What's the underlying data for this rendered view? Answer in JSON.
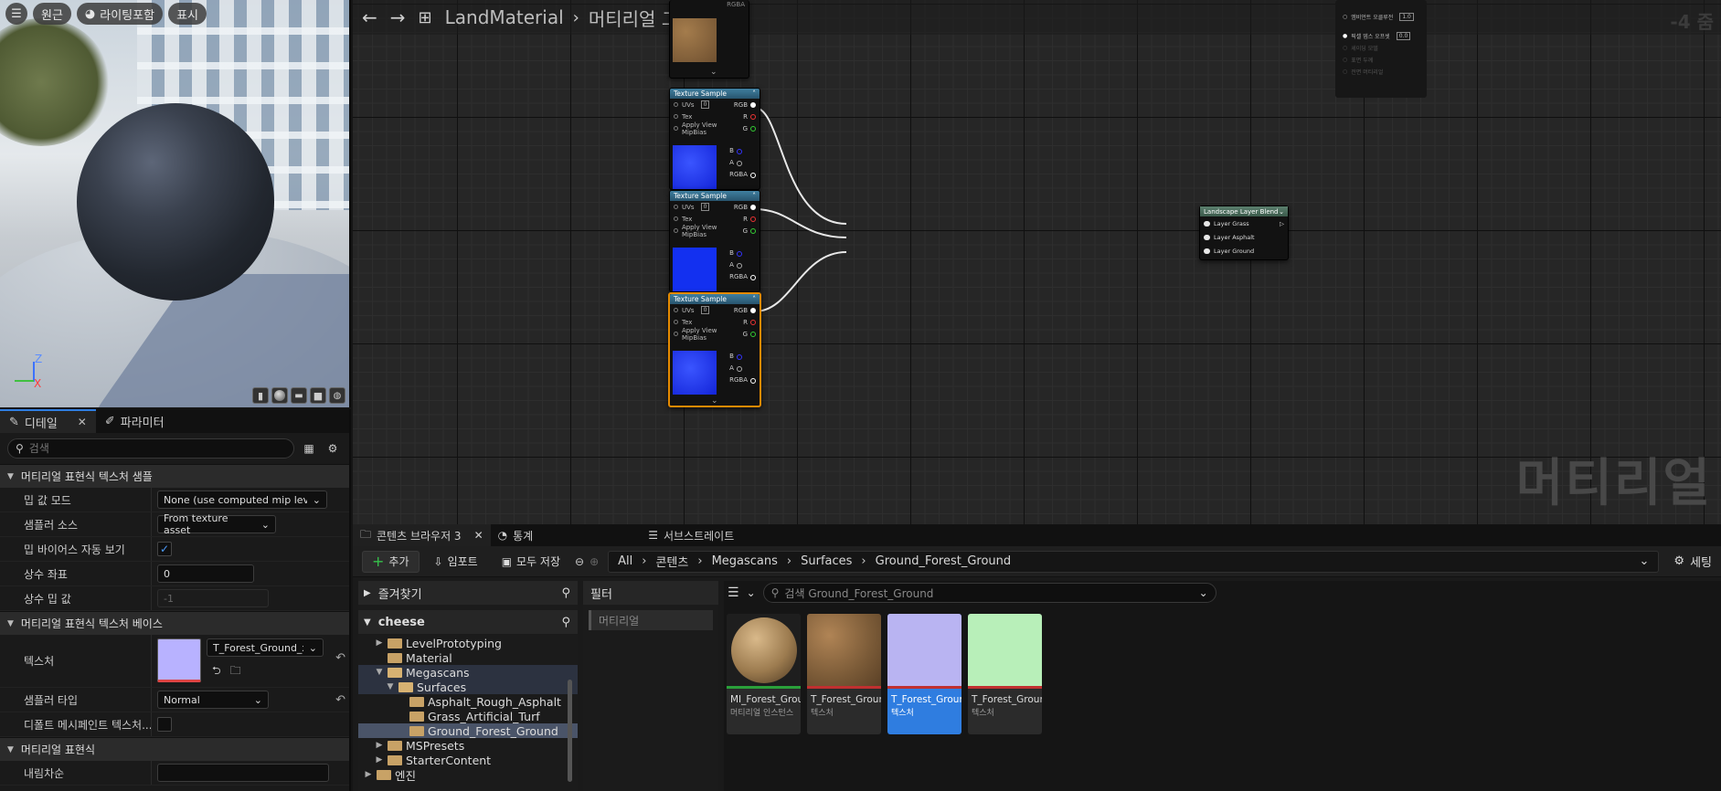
{
  "viewport": {
    "toolbar": {
      "view_mode": "원근",
      "lighting": "라이팅포함",
      "show": "표시"
    },
    "gizmo": {
      "z": "Z",
      "x": "X"
    }
  },
  "details": {
    "tabs": [
      {
        "label": "디테일"
      },
      {
        "label": "파라미터"
      }
    ],
    "search_placeholder": "검색",
    "sections": {
      "texture_sample": "머티리얼 표현식 텍스처 샘플",
      "texture_base": "머티리얼 표현식 텍스처 베이스",
      "expression": "머티리얼 표현식"
    },
    "props": {
      "mip_mode": {
        "label": "밉 값 모드",
        "value": "None (use computed mip level"
      },
      "sampler_source": {
        "label": "샘플러 소스",
        "value": "From texture asset"
      },
      "mip_bias": {
        "label": "밉 바이어스 자동 보기",
        "checked": "✓"
      },
      "const_coord": {
        "label": "상수 좌표",
        "value": "0"
      },
      "const_mip": {
        "label": "상수 밉 값",
        "value": "-1"
      },
      "texture": {
        "label": "텍스처",
        "value": "T_Forest_Ground_x"
      },
      "sampler_type": {
        "label": "샘플러 타입",
        "value": "Normal"
      },
      "default_mesh": {
        "label": "디폴트 메시페인트 텍스처..."
      },
      "desc": {
        "label": "내림차순",
        "value": ""
      }
    }
  },
  "graph": {
    "breadcrumb": {
      "asset": "LandMaterial",
      "graph": "머티리얼 그래프"
    },
    "zoom": "-4 줌",
    "watermark": "머티리얼",
    "texture_node": {
      "title": "Texture Sample",
      "uvs": "UVs",
      "uvs_val": "0",
      "tex": "Tex",
      "apply": "Apply View MipBias",
      "outputs": [
        "RGB",
        "R",
        "G",
        "B",
        "A",
        "RGBA"
      ]
    },
    "layer_blend": {
      "title": "Landscape Layer Blend",
      "pins": [
        "Layer Grass",
        "Layer Asphalt",
        "Layer Ground"
      ]
    },
    "top_node": {
      "r1": "엠비언트 오클루전",
      "r1v": "1.0",
      "r2": "픽셀 뎁스 오프셋",
      "r2v": "0.0",
      "dim": [
        "셰이딩 모델",
        "표면 두께",
        "전면 머티리얼"
      ]
    }
  },
  "content_browser": {
    "tabs": {
      "browser": "콘텐츠 브라우저 3",
      "stats": "통계",
      "substrate": "서브스트레이트"
    },
    "toolbar": {
      "add": "추가",
      "import": "임포트",
      "save_all": "모두 저장"
    },
    "path": [
      "All",
      "콘텐츠",
      "Megascans",
      "Surfaces",
      "Ground_Forest_Ground"
    ],
    "settings": "세팅",
    "favorites": "즐겨찾기",
    "project": "cheese",
    "tree": [
      {
        "label": "LevelPrototyping"
      },
      {
        "label": "Material"
      },
      {
        "label": "Megascans"
      },
      {
        "label": "Surfaces"
      },
      {
        "label": "Asphalt_Rough_Asphalt"
      },
      {
        "label": "Grass_Artificial_Turf"
      },
      {
        "label": "Ground_Forest_Ground"
      },
      {
        "label": "MSPresets"
      },
      {
        "label": "StarterContent"
      },
      {
        "label": "엔진"
      }
    ],
    "filter": {
      "title": "필터",
      "chip": "머티리얼"
    },
    "asset_search": "검색 Ground_Forest_Ground",
    "assets": [
      {
        "name": "MI_Forest_Ground_",
        "type": "머티리얼 인스턴스"
      },
      {
        "name": "T_Forest_Ground_",
        "type": "텍스처"
      },
      {
        "name": "T_Forest_Ground_",
        "type": "텍스처"
      },
      {
        "name": "T_Forest_Ground_",
        "type": "텍스처"
      }
    ]
  }
}
